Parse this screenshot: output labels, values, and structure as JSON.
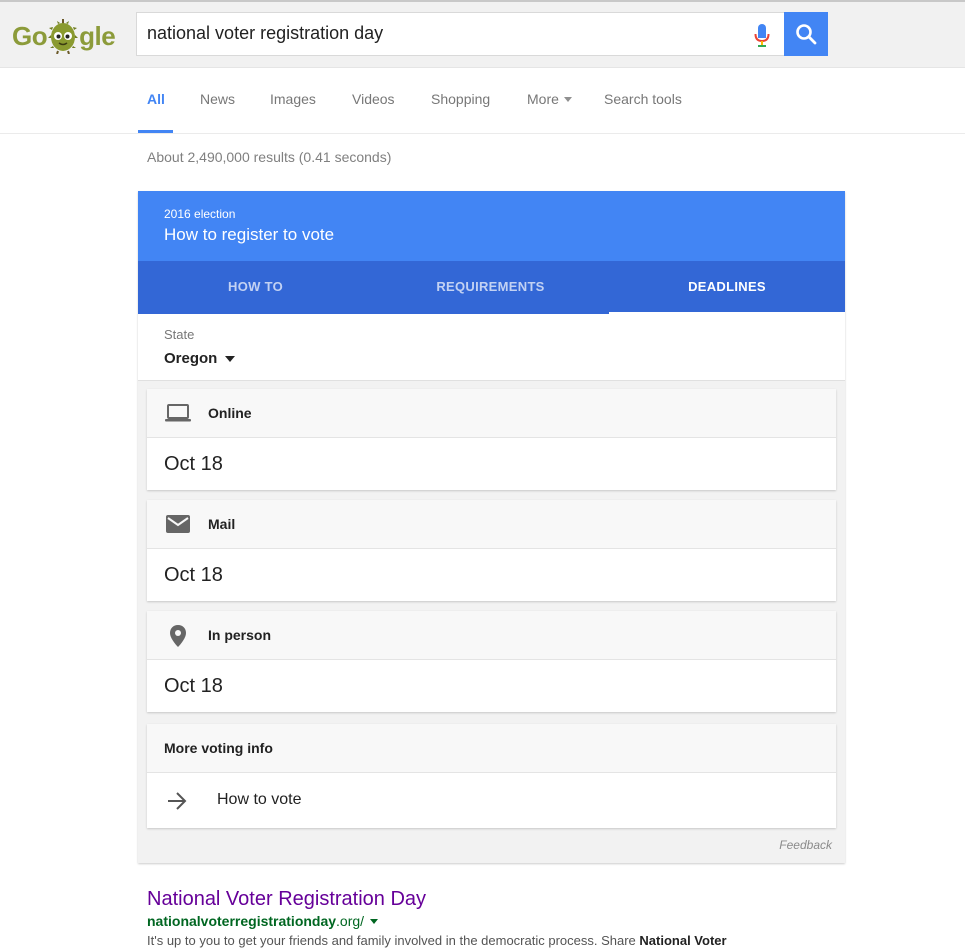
{
  "header": {
    "logo_text_left": "Go",
    "logo_text_right": "gle",
    "search_value": "national voter registration day",
    "icons": {
      "mic": "mic-icon",
      "search": "search-icon"
    }
  },
  "tabs": [
    {
      "label": "All",
      "active": true
    },
    {
      "label": "News"
    },
    {
      "label": "Images"
    },
    {
      "label": "Videos"
    },
    {
      "label": "Shopping"
    },
    {
      "label": "More"
    },
    {
      "label": "Search tools"
    }
  ],
  "result_stats": "About 2,490,000 results (0.41 seconds)",
  "card": {
    "kicker": "2016 election",
    "title": "How to register to vote",
    "tabs": [
      "HOW TO",
      "REQUIREMENTS",
      "DEADLINES"
    ],
    "active_tab": "DEADLINES",
    "state_label": "State",
    "state_value": "Oregon",
    "deadlines": [
      {
        "icon": "laptop-icon",
        "label": "Online",
        "date": "Oct 18"
      },
      {
        "icon": "mail-icon",
        "label": "Mail",
        "date": "Oct 18"
      },
      {
        "icon": "location-pin-icon",
        "label": "In person",
        "date": "Oct 18"
      }
    ],
    "more_title": "More voting info",
    "more_link": "How to vote",
    "feedback": "Feedback"
  },
  "result": {
    "title": "National Voter Registration Day",
    "url_bold": "nationalvoterregistrationday",
    "url_rest": ".org/",
    "snippet_plain": "It's up to you to get your friends and family involved in the democratic process. Share ",
    "snippet_bold": "National Voter"
  },
  "colors": {
    "brand_blue": "#4285f4",
    "tab_bar_blue": "#3367d6",
    "visited_link": "#660099",
    "url_green": "#006621"
  }
}
